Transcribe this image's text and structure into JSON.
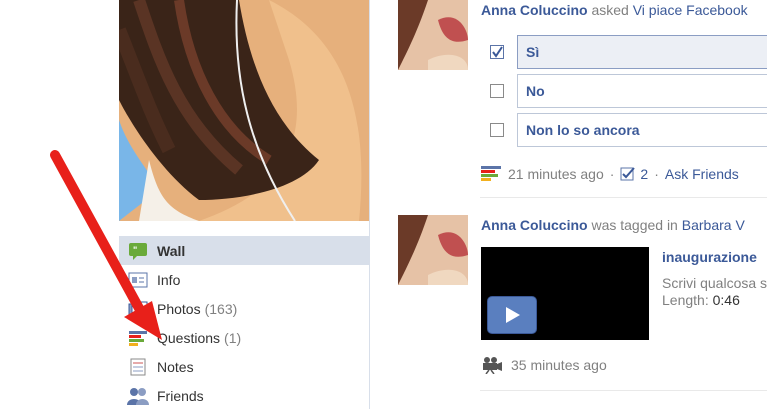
{
  "sidebar": {
    "items": [
      {
        "label": "Wall",
        "count": "",
        "icon": "wall-icon",
        "active": true
      },
      {
        "label": "Info",
        "count": "",
        "icon": "info-icon"
      },
      {
        "label": "Photos",
        "count": "(163)",
        "icon": "photos-icon"
      },
      {
        "label": "Questions",
        "count": "(1)",
        "icon": "questions-icon"
      },
      {
        "label": "Notes",
        "count": "",
        "icon": "notes-icon"
      },
      {
        "label": "Friends",
        "count": "",
        "icon": "friends-icon"
      }
    ]
  },
  "feed": {
    "question_story": {
      "author": "Anna Coluccino",
      "verb": "asked",
      "target": "Vi piace Facebook",
      "options": [
        {
          "label": "Sì",
          "checked": true
        },
        {
          "label": "No",
          "checked": false
        },
        {
          "label": "Non lo so ancora",
          "checked": false
        }
      ],
      "time": "21 minutes ago",
      "answer_count": "2",
      "ask_friends": "Ask Friends"
    },
    "video_story": {
      "author": "Anna Coluccino",
      "verb": "was tagged in",
      "target": "Barbara V",
      "video_title": "inaugurazione",
      "description": "Scrivi qualcosa s",
      "length_label": "Length:",
      "length_value": "0:46",
      "time": "35 minutes ago"
    }
  },
  "colors": {
    "link": "#3b5998",
    "arrow": "#e8201a",
    "active_nav": "#d8dfea"
  }
}
